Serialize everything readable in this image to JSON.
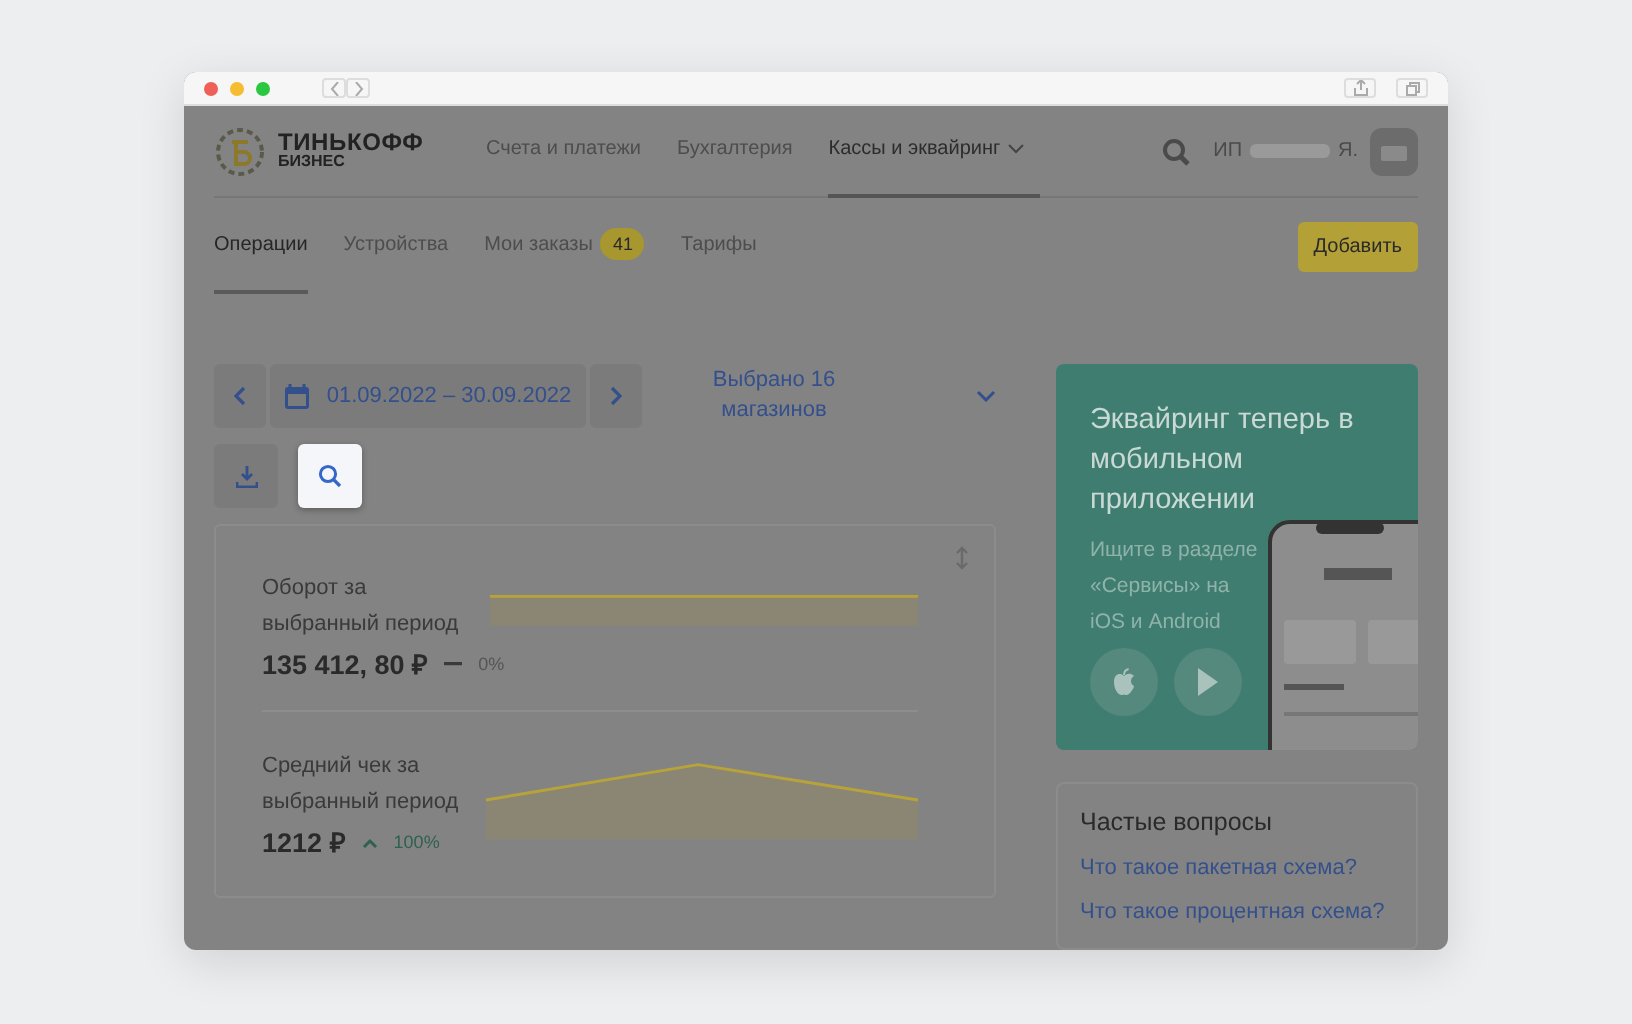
{
  "header": {
    "logo_line1": "ТИНЬКОФФ",
    "logo_line2": "БИЗНЕС",
    "user_prefix": "ИП",
    "user_suffix": "Я."
  },
  "nav": [
    {
      "label": "Счета и платежи",
      "selected": false,
      "dropdown": false
    },
    {
      "label": "Бухгалтерия",
      "selected": false,
      "dropdown": false
    },
    {
      "label": "Кассы и эквайринг",
      "selected": true,
      "dropdown": true
    }
  ],
  "tabs": [
    {
      "label": "Операции",
      "selected": true
    },
    {
      "label": "Устройства",
      "selected": false
    },
    {
      "label": "Мои заказы",
      "selected": false,
      "badge": "41"
    },
    {
      "label": "Тарифы",
      "selected": false
    }
  ],
  "add_button": "Добавить",
  "date_range": "01.09.2022 – 30.09.2022",
  "store_selector": "Выбрано 16 магазинов",
  "metrics": [
    {
      "label": "Оборот за выбранный период",
      "value": "135 412, 80 ₽",
      "kind": "flat",
      "change": "0%"
    },
    {
      "label": "Средний чек за выбранный период",
      "value": "1212 ₽",
      "kind": "up",
      "change": "100%"
    }
  ],
  "promo": {
    "title": "Эквайринг теперь в мобильном приложении",
    "text": "Ищите в разделе «Сервисы» на iOS и Android"
  },
  "faq": {
    "title": "Частые вопросы",
    "links": [
      "Что такое пакетная схема?",
      "Что такое процентная схема?"
    ]
  }
}
